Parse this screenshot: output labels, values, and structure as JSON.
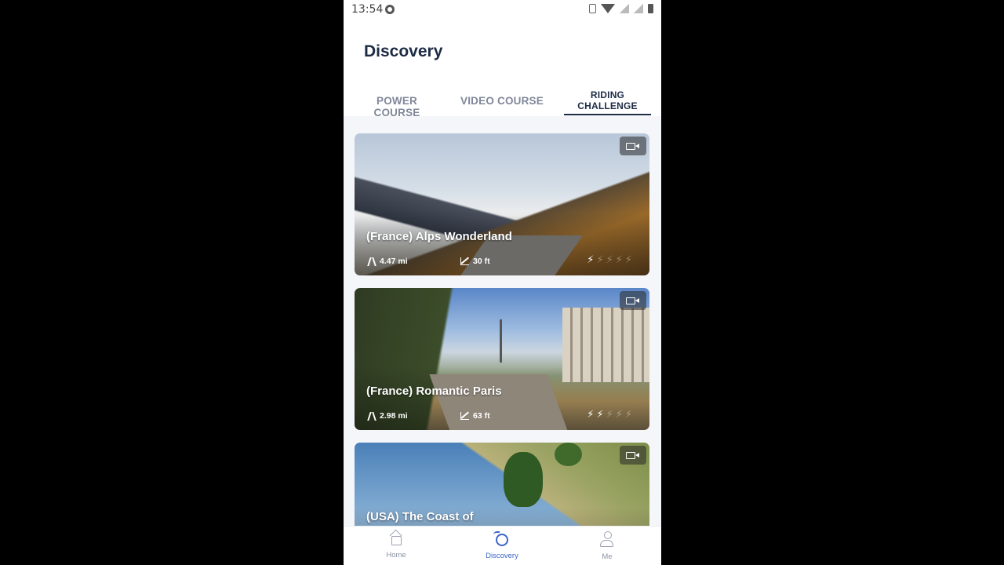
{
  "status_bar": {
    "time": "13:54"
  },
  "page": {
    "title": "Discovery"
  },
  "tabs": [
    {
      "label": "POWER COURSE",
      "active": false
    },
    {
      "label": "VIDEO COURSE",
      "active": false
    },
    {
      "label": "RIDING CHALLENGE",
      "active": true
    }
  ],
  "courses": [
    {
      "title": "(France) Alps Wonderland",
      "distance": "4.47 mi",
      "elevation": "30 ft",
      "difficulty": 1,
      "max_difficulty": 5,
      "has_video": true
    },
    {
      "title": "(France) Romantic Paris",
      "distance": "2.98 mi",
      "elevation": "63 ft",
      "difficulty": 2,
      "max_difficulty": 5,
      "has_video": true
    },
    {
      "title": "(USA) The Coast of",
      "has_video": true
    }
  ],
  "bottom_nav": [
    {
      "label": "Home",
      "icon": "home-icon",
      "active": false
    },
    {
      "label": "Discovery",
      "icon": "discovery-icon",
      "active": true
    },
    {
      "label": "Me",
      "icon": "person-icon",
      "active": false
    }
  ],
  "colors": {
    "primary_dark": "#1d2b45",
    "accent_blue": "#3b66c7",
    "tab_inactive": "#7f8799",
    "background": "#f5f6fa"
  }
}
